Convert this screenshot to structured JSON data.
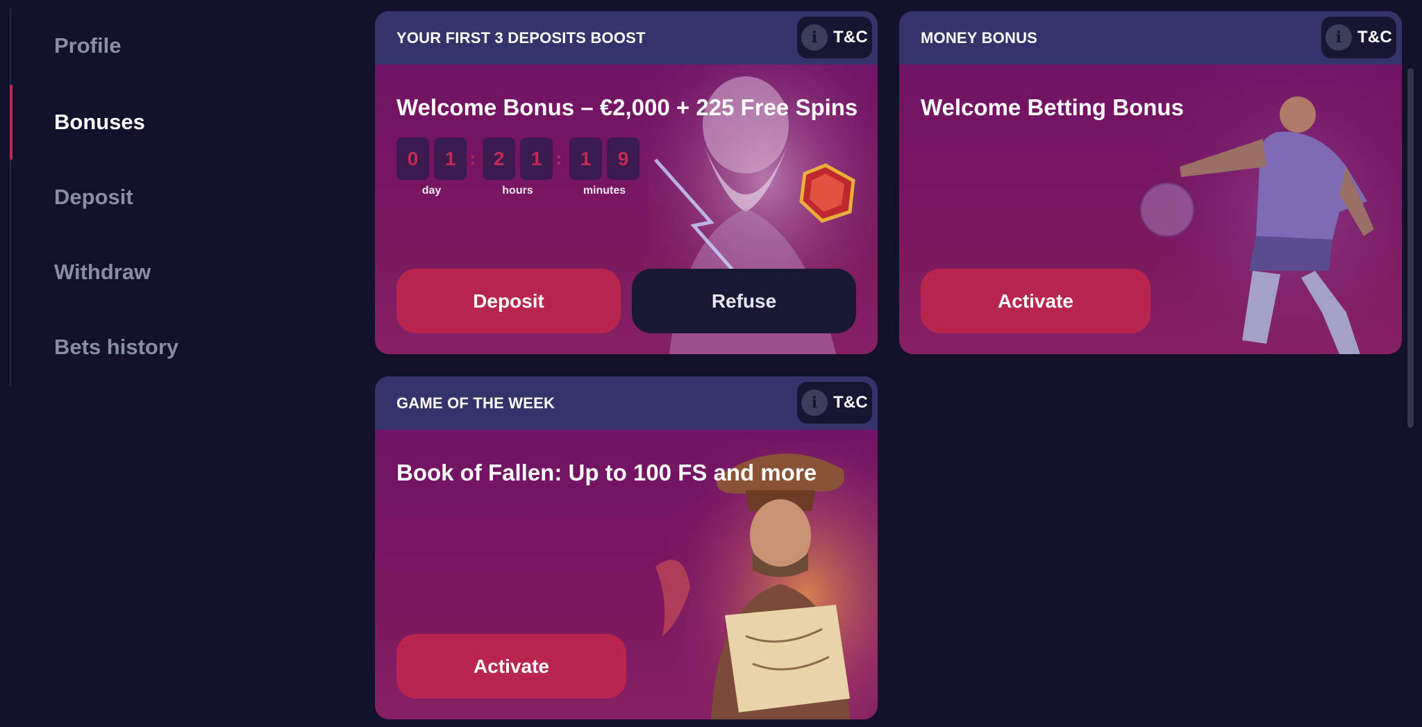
{
  "sidebar": {
    "items": [
      {
        "label": "Profile",
        "active": false
      },
      {
        "label": "Bonuses",
        "active": true
      },
      {
        "label": "Deposit",
        "active": false
      },
      {
        "label": "Withdraw",
        "active": false
      },
      {
        "label": "Bets history",
        "active": false
      }
    ]
  },
  "tc_label": "T&C",
  "tc_icon": "info-icon",
  "cards": [
    {
      "header": "YOUR FIRST 3 DEPOSITS BOOST",
      "title": "Welcome Bonus – €2,000 + 225 Free Spins",
      "countdown": {
        "digits": [
          "0",
          "1",
          "2",
          "1",
          "1",
          "9"
        ],
        "labels": {
          "day": "day",
          "hours": "hours",
          "minutes": "minutes"
        }
      },
      "primary_button": "Deposit",
      "secondary_button": "Refuse"
    },
    {
      "header": "MONEY BONUS",
      "title": "Welcome Betting Bonus",
      "primary_button": "Activate"
    },
    {
      "header": "GAME OF THE WEEK",
      "title": "Book of Fallen: Up to 100 FS and more",
      "primary_button": "Activate"
    }
  ],
  "colors": {
    "background": "#11112b",
    "card_header": "#34346a",
    "card_body": "#751464",
    "primary_button": "#b8264f",
    "dark_button": "#181834",
    "active_indicator": "#c42750"
  }
}
